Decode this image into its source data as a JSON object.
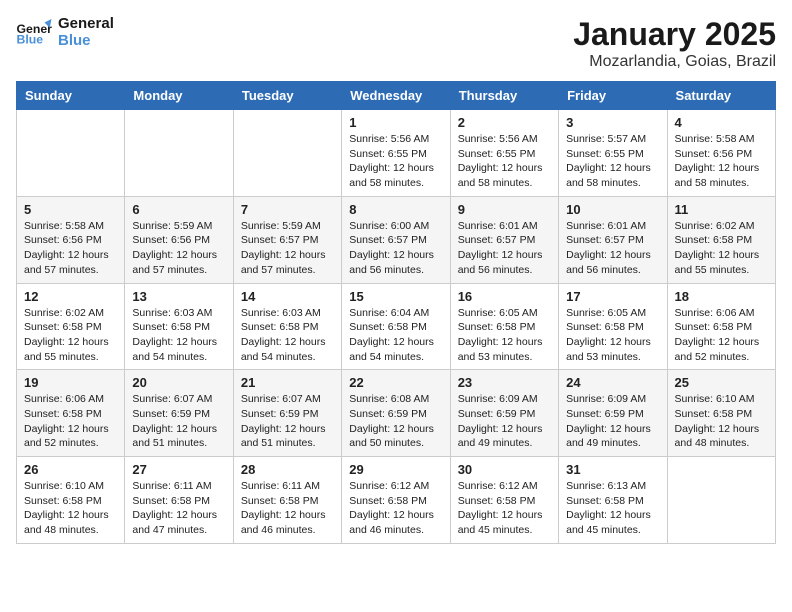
{
  "header": {
    "logo_general": "General",
    "logo_blue": "Blue",
    "title": "January 2025",
    "subtitle": "Mozarlandia, Goias, Brazil"
  },
  "weekdays": [
    "Sunday",
    "Monday",
    "Tuesday",
    "Wednesday",
    "Thursday",
    "Friday",
    "Saturday"
  ],
  "weeks": [
    [
      {
        "day": "",
        "info": ""
      },
      {
        "day": "",
        "info": ""
      },
      {
        "day": "",
        "info": ""
      },
      {
        "day": "1",
        "info": "Sunrise: 5:56 AM\nSunset: 6:55 PM\nDaylight: 12 hours\nand 58 minutes."
      },
      {
        "day": "2",
        "info": "Sunrise: 5:56 AM\nSunset: 6:55 PM\nDaylight: 12 hours\nand 58 minutes."
      },
      {
        "day": "3",
        "info": "Sunrise: 5:57 AM\nSunset: 6:55 PM\nDaylight: 12 hours\nand 58 minutes."
      },
      {
        "day": "4",
        "info": "Sunrise: 5:58 AM\nSunset: 6:56 PM\nDaylight: 12 hours\nand 58 minutes."
      }
    ],
    [
      {
        "day": "5",
        "info": "Sunrise: 5:58 AM\nSunset: 6:56 PM\nDaylight: 12 hours\nand 57 minutes."
      },
      {
        "day": "6",
        "info": "Sunrise: 5:59 AM\nSunset: 6:56 PM\nDaylight: 12 hours\nand 57 minutes."
      },
      {
        "day": "7",
        "info": "Sunrise: 5:59 AM\nSunset: 6:57 PM\nDaylight: 12 hours\nand 57 minutes."
      },
      {
        "day": "8",
        "info": "Sunrise: 6:00 AM\nSunset: 6:57 PM\nDaylight: 12 hours\nand 56 minutes."
      },
      {
        "day": "9",
        "info": "Sunrise: 6:01 AM\nSunset: 6:57 PM\nDaylight: 12 hours\nand 56 minutes."
      },
      {
        "day": "10",
        "info": "Sunrise: 6:01 AM\nSunset: 6:57 PM\nDaylight: 12 hours\nand 56 minutes."
      },
      {
        "day": "11",
        "info": "Sunrise: 6:02 AM\nSunset: 6:58 PM\nDaylight: 12 hours\nand 55 minutes."
      }
    ],
    [
      {
        "day": "12",
        "info": "Sunrise: 6:02 AM\nSunset: 6:58 PM\nDaylight: 12 hours\nand 55 minutes."
      },
      {
        "day": "13",
        "info": "Sunrise: 6:03 AM\nSunset: 6:58 PM\nDaylight: 12 hours\nand 54 minutes."
      },
      {
        "day": "14",
        "info": "Sunrise: 6:03 AM\nSunset: 6:58 PM\nDaylight: 12 hours\nand 54 minutes."
      },
      {
        "day": "15",
        "info": "Sunrise: 6:04 AM\nSunset: 6:58 PM\nDaylight: 12 hours\nand 54 minutes."
      },
      {
        "day": "16",
        "info": "Sunrise: 6:05 AM\nSunset: 6:58 PM\nDaylight: 12 hours\nand 53 minutes."
      },
      {
        "day": "17",
        "info": "Sunrise: 6:05 AM\nSunset: 6:58 PM\nDaylight: 12 hours\nand 53 minutes."
      },
      {
        "day": "18",
        "info": "Sunrise: 6:06 AM\nSunset: 6:58 PM\nDaylight: 12 hours\nand 52 minutes."
      }
    ],
    [
      {
        "day": "19",
        "info": "Sunrise: 6:06 AM\nSunset: 6:58 PM\nDaylight: 12 hours\nand 52 minutes."
      },
      {
        "day": "20",
        "info": "Sunrise: 6:07 AM\nSunset: 6:59 PM\nDaylight: 12 hours\nand 51 minutes."
      },
      {
        "day": "21",
        "info": "Sunrise: 6:07 AM\nSunset: 6:59 PM\nDaylight: 12 hours\nand 51 minutes."
      },
      {
        "day": "22",
        "info": "Sunrise: 6:08 AM\nSunset: 6:59 PM\nDaylight: 12 hours\nand 50 minutes."
      },
      {
        "day": "23",
        "info": "Sunrise: 6:09 AM\nSunset: 6:59 PM\nDaylight: 12 hours\nand 49 minutes."
      },
      {
        "day": "24",
        "info": "Sunrise: 6:09 AM\nSunset: 6:59 PM\nDaylight: 12 hours\nand 49 minutes."
      },
      {
        "day": "25",
        "info": "Sunrise: 6:10 AM\nSunset: 6:58 PM\nDaylight: 12 hours\nand 48 minutes."
      }
    ],
    [
      {
        "day": "26",
        "info": "Sunrise: 6:10 AM\nSunset: 6:58 PM\nDaylight: 12 hours\nand 48 minutes."
      },
      {
        "day": "27",
        "info": "Sunrise: 6:11 AM\nSunset: 6:58 PM\nDaylight: 12 hours\nand 47 minutes."
      },
      {
        "day": "28",
        "info": "Sunrise: 6:11 AM\nSunset: 6:58 PM\nDaylight: 12 hours\nand 46 minutes."
      },
      {
        "day": "29",
        "info": "Sunrise: 6:12 AM\nSunset: 6:58 PM\nDaylight: 12 hours\nand 46 minutes."
      },
      {
        "day": "30",
        "info": "Sunrise: 6:12 AM\nSunset: 6:58 PM\nDaylight: 12 hours\nand 45 minutes."
      },
      {
        "day": "31",
        "info": "Sunrise: 6:13 AM\nSunset: 6:58 PM\nDaylight: 12 hours\nand 45 minutes."
      },
      {
        "day": "",
        "info": ""
      }
    ]
  ]
}
